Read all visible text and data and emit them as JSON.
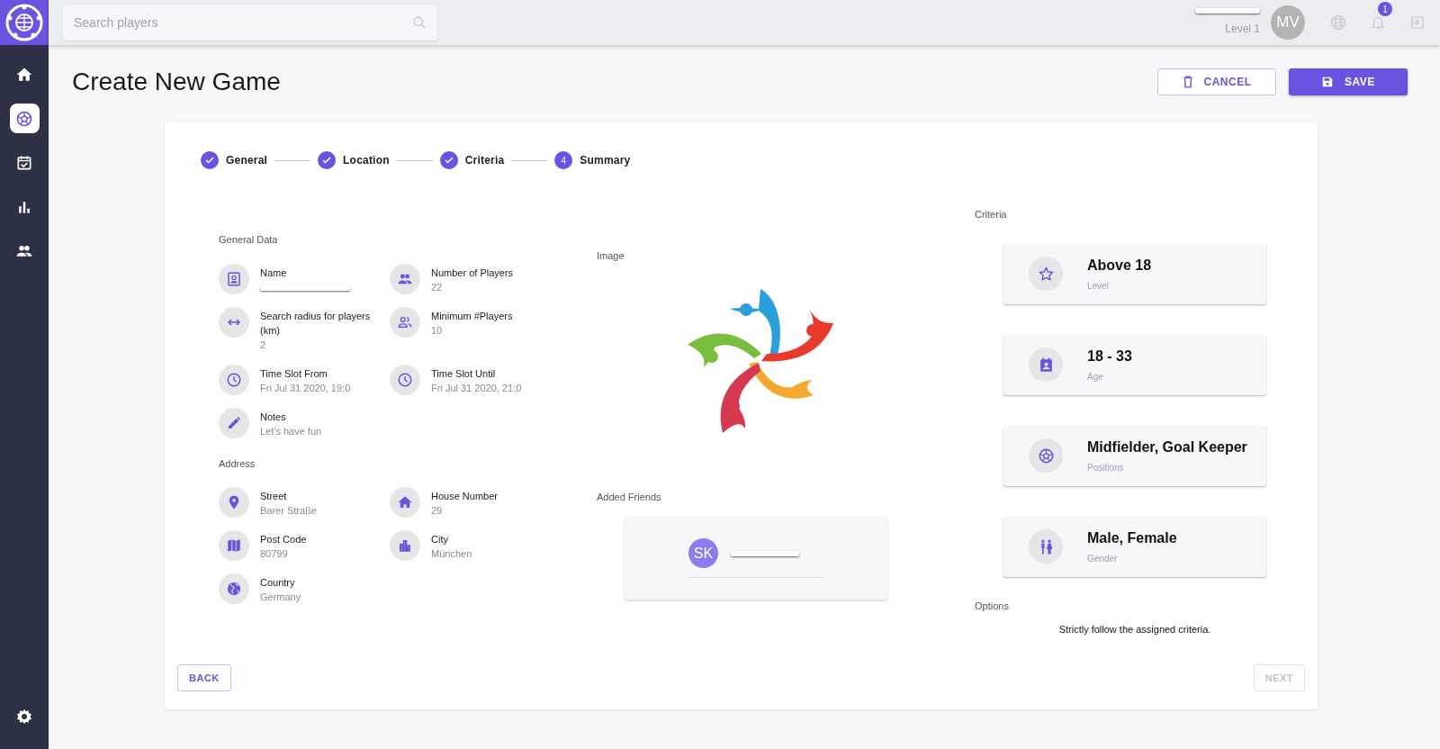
{
  "sidebar": {
    "items": [
      {
        "kind": "home",
        "selected": false
      },
      {
        "kind": "ball",
        "selected": true
      },
      {
        "kind": "calendar",
        "selected": false
      },
      {
        "kind": "chart",
        "selected": false
      },
      {
        "kind": "people",
        "selected": false
      }
    ],
    "bottom_item": {
      "kind": "settings",
      "selected": false
    }
  },
  "top_bar": {
    "search": {
      "placeholder": "Search players"
    },
    "user": {
      "name_redacted": true,
      "level": "Level 1",
      "initials": "MV"
    },
    "notifications": {
      "count": "1"
    }
  },
  "page": {
    "title": "Create New Game",
    "actions": [
      {
        "kind": "cancel",
        "label": "CANCEL"
      },
      {
        "kind": "save",
        "label": "SAVE"
      }
    ]
  },
  "stepper": [
    {
      "label": "General",
      "completed": true
    },
    {
      "label": "Location",
      "completed": true
    },
    {
      "label": "Criteria",
      "completed": true
    },
    {
      "label": "Summary",
      "completed": false,
      "number": "4"
    }
  ],
  "general_data": {
    "heading": "General Data",
    "fields": [
      {
        "kind": "badge",
        "label": "Name",
        "redacted": true
      },
      {
        "kind": "people",
        "label": "Number of Players",
        "value": "22"
      },
      {
        "kind": "arrows",
        "label": "Search radius for players (km)",
        "value": "2"
      },
      {
        "kind": "people-outline",
        "label": "Minimum #Players",
        "value": "10"
      },
      {
        "kind": "clock",
        "label": "Time Slot From",
        "value": "Fri Jul 31 2020, 19:0"
      },
      {
        "kind": "clock",
        "label": "Time Slot Until",
        "value": "Fri Jul 31 2020, 21:0"
      },
      {
        "kind": "pencil",
        "label": "Notes",
        "value": "Let's have fun"
      }
    ]
  },
  "address": {
    "heading": "Address",
    "fields": [
      {
        "kind": "pin",
        "label": "Street",
        "value": "Barer Straße"
      },
      {
        "kind": "house",
        "label": "House Number",
        "value": "29"
      },
      {
        "kind": "map",
        "label": "Post Code",
        "value": "80799"
      },
      {
        "kind": "city",
        "label": "City",
        "value": "München"
      },
      {
        "kind": "globe",
        "label": "Country",
        "value": "Germany"
      }
    ]
  },
  "image": {
    "heading": "Image",
    "kind": "picture"
  },
  "added_friends": {
    "heading": "Added Friends",
    "friends": [
      {
        "initials": "SK",
        "name_redacted": true
      }
    ]
  },
  "criteria": {
    "heading": "Criteria",
    "items": [
      {
        "kind": "star",
        "value": "Above 18",
        "label": "Level"
      },
      {
        "kind": "contact",
        "value": "18 - 33",
        "label": "Age"
      },
      {
        "kind": "ball",
        "value": "Midfielder, Goal Keeper",
        "label": "Positions"
      },
      {
        "kind": "gender",
        "value": "Male, Female",
        "label": "Gender"
      }
    ]
  },
  "options": {
    "heading": "Options",
    "text": "Strictly follow the assigned criteria."
  },
  "footer": {
    "back": {
      "label": "BACK",
      "disabled": false
    },
    "next": {
      "label": "NEXT",
      "disabled": true
    }
  }
}
